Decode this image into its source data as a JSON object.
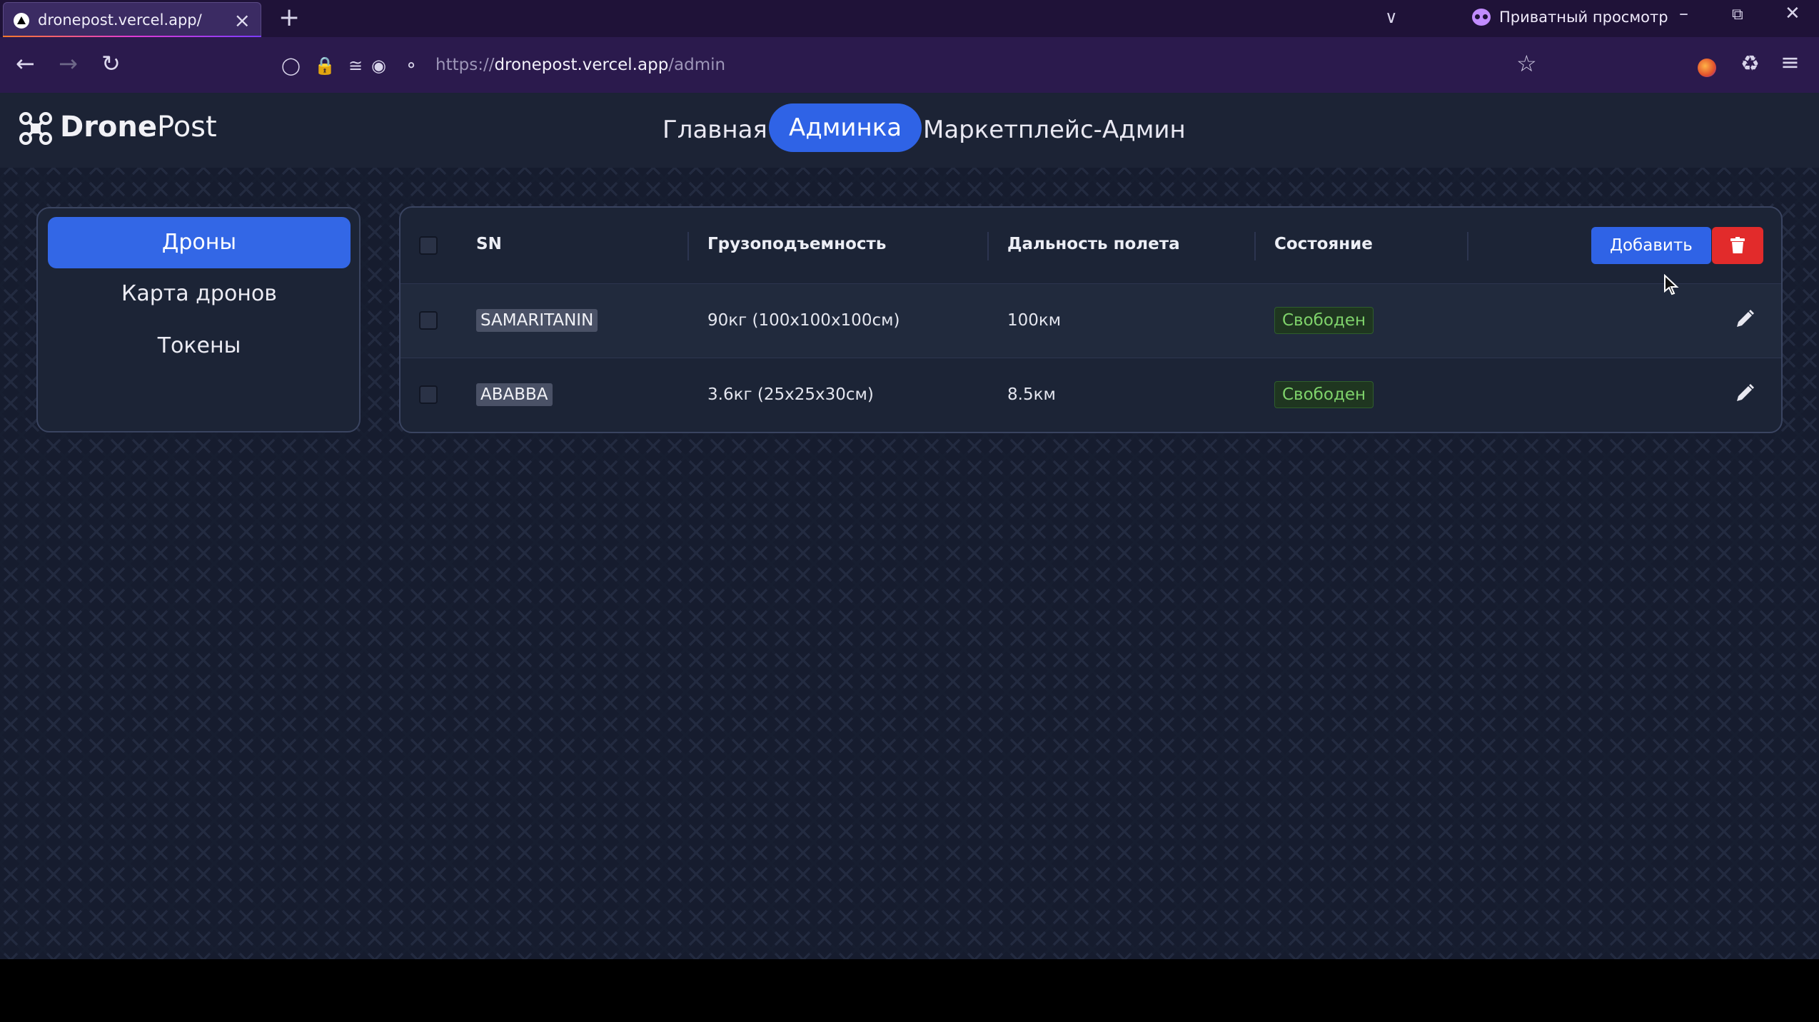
{
  "browser": {
    "tab_title": "dronepost.vercel.app/",
    "new_tab": "+",
    "tab_close": "×",
    "private_label": "Приватный просмотр",
    "url_prefix": "https://",
    "url_host": "dronepost.vercel.app",
    "url_path": "/admin"
  },
  "header": {
    "logo_prefix": "Drone",
    "logo_suffix": "Post",
    "nav": [
      "Главная",
      "Админка",
      "Маркетплейс-Админ"
    ],
    "active_nav": "Админка"
  },
  "sidebar": {
    "items": [
      "Дроны",
      "Карта дронов",
      "Токены"
    ],
    "active": "Дроны"
  },
  "table": {
    "columns": [
      "SN",
      "Грузоподъемность",
      "Дальность полета",
      "Состояние"
    ],
    "add_label": "Добавить",
    "rows": [
      {
        "sn": "SAMARITANIN",
        "capacity": "90кг (100x100x100см)",
        "range": "100км",
        "status": "Свободен"
      },
      {
        "sn": "ABABBA",
        "capacity": "3.6кг (25x25x30см)",
        "range": "8.5км",
        "status": "Свободен"
      }
    ]
  },
  "colors": {
    "accent": "#2f63e6",
    "danger": "#e22b2b",
    "status_free": "#7fd36b",
    "background": "#161c2e"
  }
}
